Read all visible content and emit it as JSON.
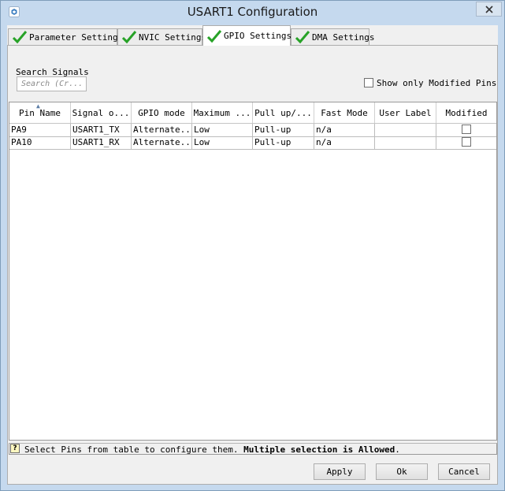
{
  "window": {
    "title": "USART1 Configuration"
  },
  "tabs": [
    {
      "label": "Parameter Settings",
      "active": false
    },
    {
      "label": "NVIC Settings",
      "active": false
    },
    {
      "label": "GPIO Settings",
      "active": true
    },
    {
      "label": "DMA Settings",
      "active": false
    }
  ],
  "search": {
    "label": "Search Signals",
    "placeholder": "Search (Cr..."
  },
  "filter": {
    "label": "Show only Modified Pins",
    "checked": false
  },
  "table": {
    "columns": [
      "Pin Name",
      "Signal o...",
      "GPIO mode",
      "Maximum ...",
      "Pull up/...",
      "Fast Mode",
      "User Label",
      "Modified"
    ],
    "rows": [
      {
        "pin": "PA9",
        "signal": "USART1_TX",
        "mode": "Alternate...",
        "maximum": "Low",
        "pull": "Pull-up",
        "fast": "n/a",
        "label": "",
        "modified": false
      },
      {
        "pin": "PA10",
        "signal": "USART1_RX",
        "mode": "Alternate...",
        "maximum": "Low",
        "pull": "Pull-up",
        "fast": "n/a",
        "label": "",
        "modified": false
      }
    ]
  },
  "status": {
    "icon": "?",
    "text": "Select Pins from table to configure them. ",
    "emphasis": "Multiple selection is Allowed",
    "suffix": "."
  },
  "buttons": {
    "apply": "Apply",
    "ok": "Ok",
    "cancel": "Cancel"
  },
  "colors": {
    "check_green": "#27a227",
    "title_bar": "#c5d9ee",
    "panel": "#f0f0f0"
  }
}
